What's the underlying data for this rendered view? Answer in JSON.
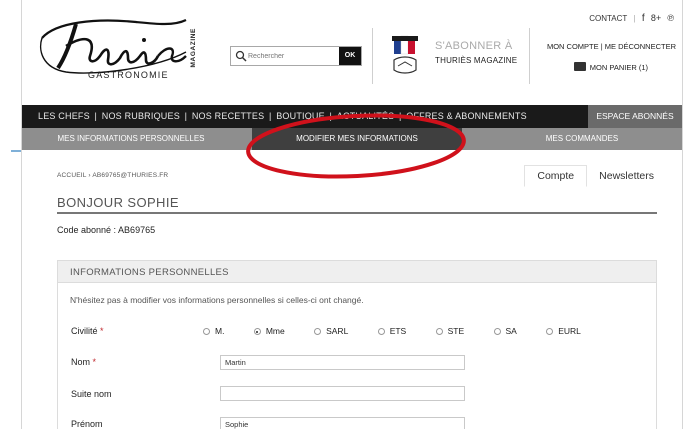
{
  "header": {
    "logo_text": "Thuriès",
    "logo_sub": "GASTRONOMIE",
    "logo_mag": "MAGAZINE",
    "search": {
      "placeholder": "Rechercher",
      "ok_label": "OK"
    },
    "subscribe": {
      "line1": "S'ABONNER À",
      "line2": "THURIÈS MAGAZINE"
    },
    "contact_label": "CONTACT",
    "social": [
      "f",
      "8+",
      "℗"
    ],
    "account_links": "MON COMPTE | ME DÉCONNECTER",
    "basket_label": "MON PANIER (1)"
  },
  "main_nav": {
    "items": [
      "LES CHEFS",
      "NOS RUBRIQUES",
      "NOS RECETTES",
      "BOUTIQUE",
      "ACTUALITÉS",
      "OFFRES & ABONNEMENTS"
    ],
    "espace_label": "ESPACE ABONNÉS"
  },
  "sub_nav": {
    "tabs": [
      "MES INFORMATIONS PERSONNELLES",
      "MODIFIER MES INFORMATIONS",
      "MES COMMANDES"
    ]
  },
  "breadcrumb": "ACCUEIL › AB69765@THURIES.FR",
  "account_tabs": [
    "Compte",
    "Newsletters"
  ],
  "greeting": "BONJOUR SOPHIE",
  "subscriber_code": "Code abonné :  AB69765",
  "panel": {
    "title": "INFORMATIONS PERSONNELLES",
    "intro": "N'hésitez pas à modifier vos informations personnelles si celles-ci ont changé.",
    "civility_label": "Civilité",
    "civility_options": [
      "M.",
      "Mme",
      "SARL",
      "ETS",
      "STE",
      "SA",
      "EURL"
    ],
    "civility_selected": "Mme",
    "nom_label": "Nom",
    "nom_value": "Martin",
    "suite_nom_label": "Suite nom",
    "suite_nom_value": "",
    "prenom_label": "Prénom",
    "prenom_value": "Sophie"
  },
  "colors": {
    "nav_dark": "#1a1a1a",
    "subnav_grey": "#8e8e8e",
    "active_tab": "#3f3f3f",
    "highlight_red": "#d0111b",
    "required": "#c0272d"
  }
}
